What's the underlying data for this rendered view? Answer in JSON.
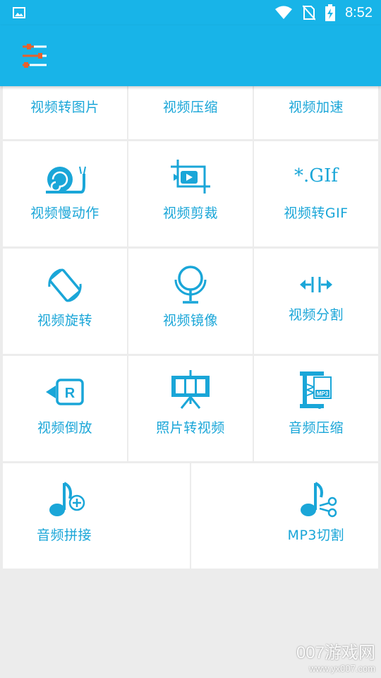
{
  "status_bar": {
    "time": "8:52",
    "icons": [
      "image-icon",
      "wifi-icon",
      "no-sim-icon",
      "battery-charging-icon"
    ]
  },
  "app_bar": {
    "menu_icon": "equalizer-menu-icon"
  },
  "colors": {
    "accent": "#18b4e8",
    "label": "#1aa6d8",
    "background": "#ececec"
  },
  "tools": {
    "row1": [
      {
        "label": "视频转图片"
      },
      {
        "label": "视频压缩"
      },
      {
        "label": "视频加速"
      }
    ],
    "row2": [
      {
        "label": "视频慢动作",
        "icon": "snail-icon"
      },
      {
        "label": "视频剪裁",
        "icon": "crop-video-icon"
      },
      {
        "label": "视频转GIF",
        "icon": "gif-icon",
        "icon_text": "*.GIf"
      }
    ],
    "row3": [
      {
        "label": "视频旋转",
        "icon": "rotate-icon"
      },
      {
        "label": "视频镜像",
        "icon": "mirror-icon"
      },
      {
        "label": "视频分割",
        "icon": "split-icon"
      }
    ],
    "row4": [
      {
        "label": "视频倒放",
        "icon": "reverse-video-icon"
      },
      {
        "label": "照片转视频",
        "icon": "photo-to-video-icon"
      },
      {
        "label": "音频压缩",
        "icon": "audio-compress-icon",
        "icon_text": "MP3"
      }
    ],
    "row5": [
      {
        "label": "音频拼接",
        "icon": "music-add-icon"
      },
      {
        "label": "MP3切割",
        "icon": "music-cut-icon"
      }
    ]
  },
  "watermark": {
    "big": "007游戏网",
    "small": "www.yx007.com"
  }
}
